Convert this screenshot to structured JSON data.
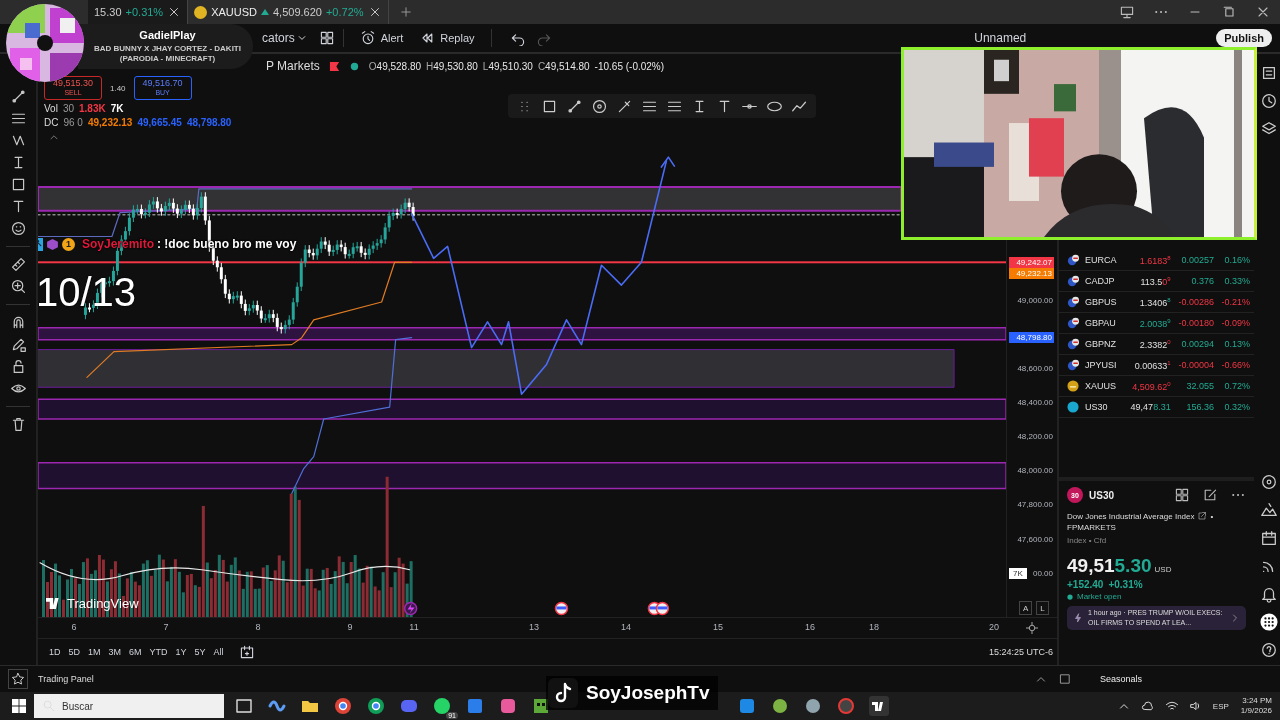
{
  "tabs": [
    {
      "price": "15.30",
      "change": "+0.31%",
      "selected": true
    },
    {
      "label": "XAUUSD",
      "price": "4,509.620",
      "change": "+0.72%",
      "selected": false
    }
  ],
  "toolbar": {
    "indicators": "cators",
    "alert": "Alert",
    "replay": "Replay",
    "layout_name": "Unnamed",
    "publish": "Publish"
  },
  "legend": {
    "symbol_tail": "P Markets",
    "ohlc": [
      {
        "k": "O",
        "v": "49,528.80"
      },
      {
        "k": "H",
        "v": "49,530.80"
      },
      {
        "k": "L",
        "v": "49,510.30"
      },
      {
        "k": "C",
        "v": "49,514.80"
      }
    ],
    "change": "-10.65 (-0.02%)"
  },
  "trade": {
    "sell_price": "49,515.30",
    "sell": "SELL",
    "spread": "1.40",
    "buy_price": "49,516.70",
    "buy": "BUY"
  },
  "indicators": [
    {
      "name": "Vol",
      "params": "30",
      "values": [
        {
          "text": "1.83K",
          "color": "#f23645"
        },
        {
          "text": "7K",
          "color": "#ffffff"
        }
      ]
    },
    {
      "name": "DC",
      "params": "96 0",
      "values": [
        {
          "text": "49,232.13",
          "color": "#f57c00"
        },
        {
          "text": "49,665.45",
          "color": "#2962ff"
        },
        {
          "text": "48,798.80",
          "color": "#2962ff"
        }
      ]
    }
  ],
  "price_axis": {
    "ticks": [
      "49,000.00",
      "48,600.00",
      "48,400.00",
      "48,200.00",
      "48,000.00",
      "47,800.00",
      "47,600.00",
      "00.00"
    ],
    "markers": [
      {
        "text": "49,242.07",
        "color": "#f23645"
      },
      {
        "text": "49,232.13",
        "color": "#f57c00"
      },
      {
        "text": "48,798.80",
        "color": "#2962ff"
      }
    ],
    "volume_marker": "7K",
    "scale_buttons": [
      "A",
      "L"
    ]
  },
  "time_axis": [
    "6",
    "7",
    "8",
    "9",
    "11",
    "13",
    "14",
    "15",
    "16",
    "18",
    "20"
  ],
  "ranges": [
    "1D",
    "5D",
    "1M",
    "3M",
    "6M",
    "YTD",
    "1Y",
    "5Y",
    "All"
  ],
  "clock": "15:24:25 UTC-6",
  "watchlist": [
    {
      "symbol": "EURCA",
      "kind": "pair",
      "price": "1.6183",
      "pip": "8",
      "price_up": false,
      "change": "0.00257",
      "percent": "0.16%",
      "change_up": true
    },
    {
      "symbol": "CADJP",
      "kind": "pair",
      "price_lead": "113.5",
      "price": "0",
      "pip": "9",
      "price_up": false,
      "change": "0.376",
      "percent": "0.33%",
      "change_up": true
    },
    {
      "symbol": "GBPUS",
      "kind": "pair",
      "price_lead": "1.3406",
      "pip": "8",
      "price_up": true,
      "change": "-0.00286",
      "percent": "-0.21%",
      "change_up": false
    },
    {
      "symbol": "GBPAU",
      "kind": "pair",
      "price": "2.0038",
      "pip": "9",
      "price_up": true,
      "change": "-0.00180",
      "percent": "-0.09%",
      "change_up": false
    },
    {
      "symbol": "GBPNZ",
      "kind": "pair",
      "price_lead": "2.3382",
      "pip": "0",
      "price_up": false,
      "change": "0.00294",
      "percent": "0.13%",
      "change_up": true
    },
    {
      "symbol": "JPYUSI",
      "kind": "pair",
      "price_lead": "0.00633",
      "pip": "1",
      "price_up": false,
      "change": "-0.00004",
      "percent": "-0.66%",
      "change_up": false
    },
    {
      "symbol": "XAUUS",
      "kind": "gold",
      "price": "4,509.62",
      "pip": "0",
      "price_up": false,
      "change": "32.055",
      "percent": "0.72%",
      "change_up": true
    },
    {
      "symbol": "US30",
      "kind": "index",
      "price_lead": "49,47",
      "price": "8.31",
      "price_up": true,
      "change": "156.36",
      "percent": "0.32%",
      "change_up": true
    }
  ],
  "detail": {
    "badge": "30",
    "symbol": "US30",
    "name": "Dow Jones Industrial Average Index",
    "separator": "•",
    "exchange": "FPMARKETS",
    "type": "Index • Cfd",
    "price_lead": "49,51",
    "price_tail": "5.30",
    "currency": "USD",
    "change": "+152.40",
    "change_pct": "+0.31%",
    "status": "Market open",
    "news_time": "1 hour ago",
    "news_headline": "· PRES TRUMP W/OIL EXECS: OIL FIRMS TO SPEND AT LEA..."
  },
  "bottom_bar": {
    "trading_panel": "Trading Panel",
    "seasonals": "Seasonals"
  },
  "taskbar": {
    "search_placeholder": "Buscar",
    "badge": "91",
    "language": "ESP",
    "time": "3:24 PM",
    "date": "1/9/2026"
  },
  "overlays": {
    "now_playing": {
      "channel": "GadielPlay",
      "title": "BAD BUNNY X JHAY CORTEZ - DAKITI",
      "subtitle": "(PARODIA - MINECRAFT)"
    },
    "chat": {
      "badge_count": "1",
      "user": "SoyJeremito",
      "message": ": !doc bueno bro me voy"
    },
    "counter": "10/13",
    "stream_tag": "SoyJosephTv",
    "chart_logo": "TradingView"
  }
}
